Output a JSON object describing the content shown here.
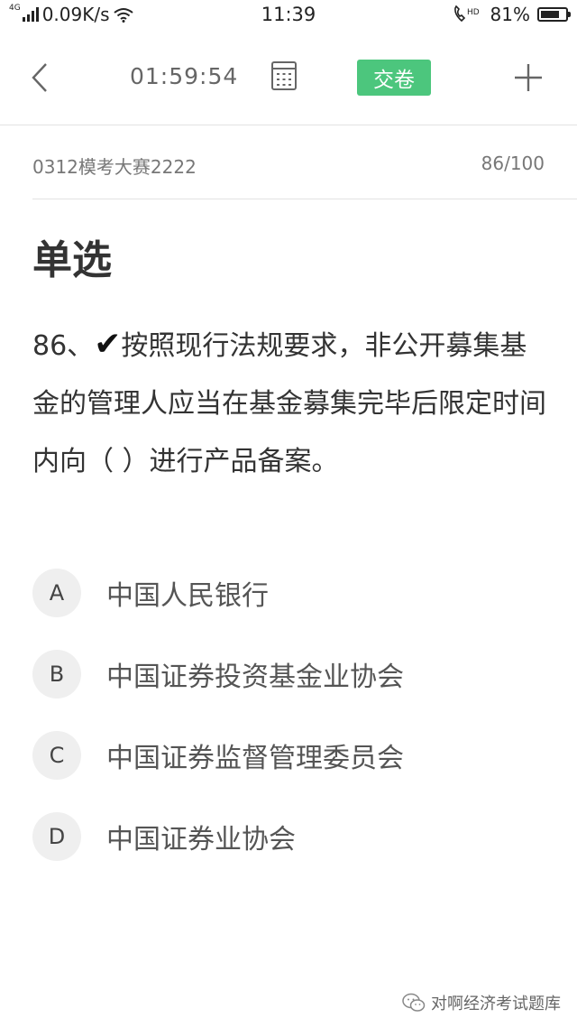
{
  "status_bar": {
    "network_badge": "4G",
    "speed": "0.09K/s",
    "time": "11:39",
    "hd_label": "HD",
    "battery_percent": "81%",
    "battery_level": 0.81
  },
  "toolbar": {
    "timer": "01:59:54",
    "submit_label": "交卷"
  },
  "exam": {
    "name": "0312模考大赛2222",
    "progress": "86/100"
  },
  "question": {
    "type": "单选",
    "number_prefix": "86、",
    "check_mark": "✔",
    "text": "按照现行法规要求，非公开募集基金的管理人应当在基金募集完毕后限定时间内向（ ）进行产品备案。"
  },
  "options": [
    {
      "letter": "A",
      "text": "中国人民银行"
    },
    {
      "letter": "B",
      "text": "中国证券投资基金业协会"
    },
    {
      "letter": "C",
      "text": "中国证券监督管理委员会"
    },
    {
      "letter": "D",
      "text": "中国证券业协会"
    }
  ],
  "watermark": {
    "text": "对啊经济考试题库"
  },
  "colors": {
    "accent_green": "#4cc67d"
  }
}
